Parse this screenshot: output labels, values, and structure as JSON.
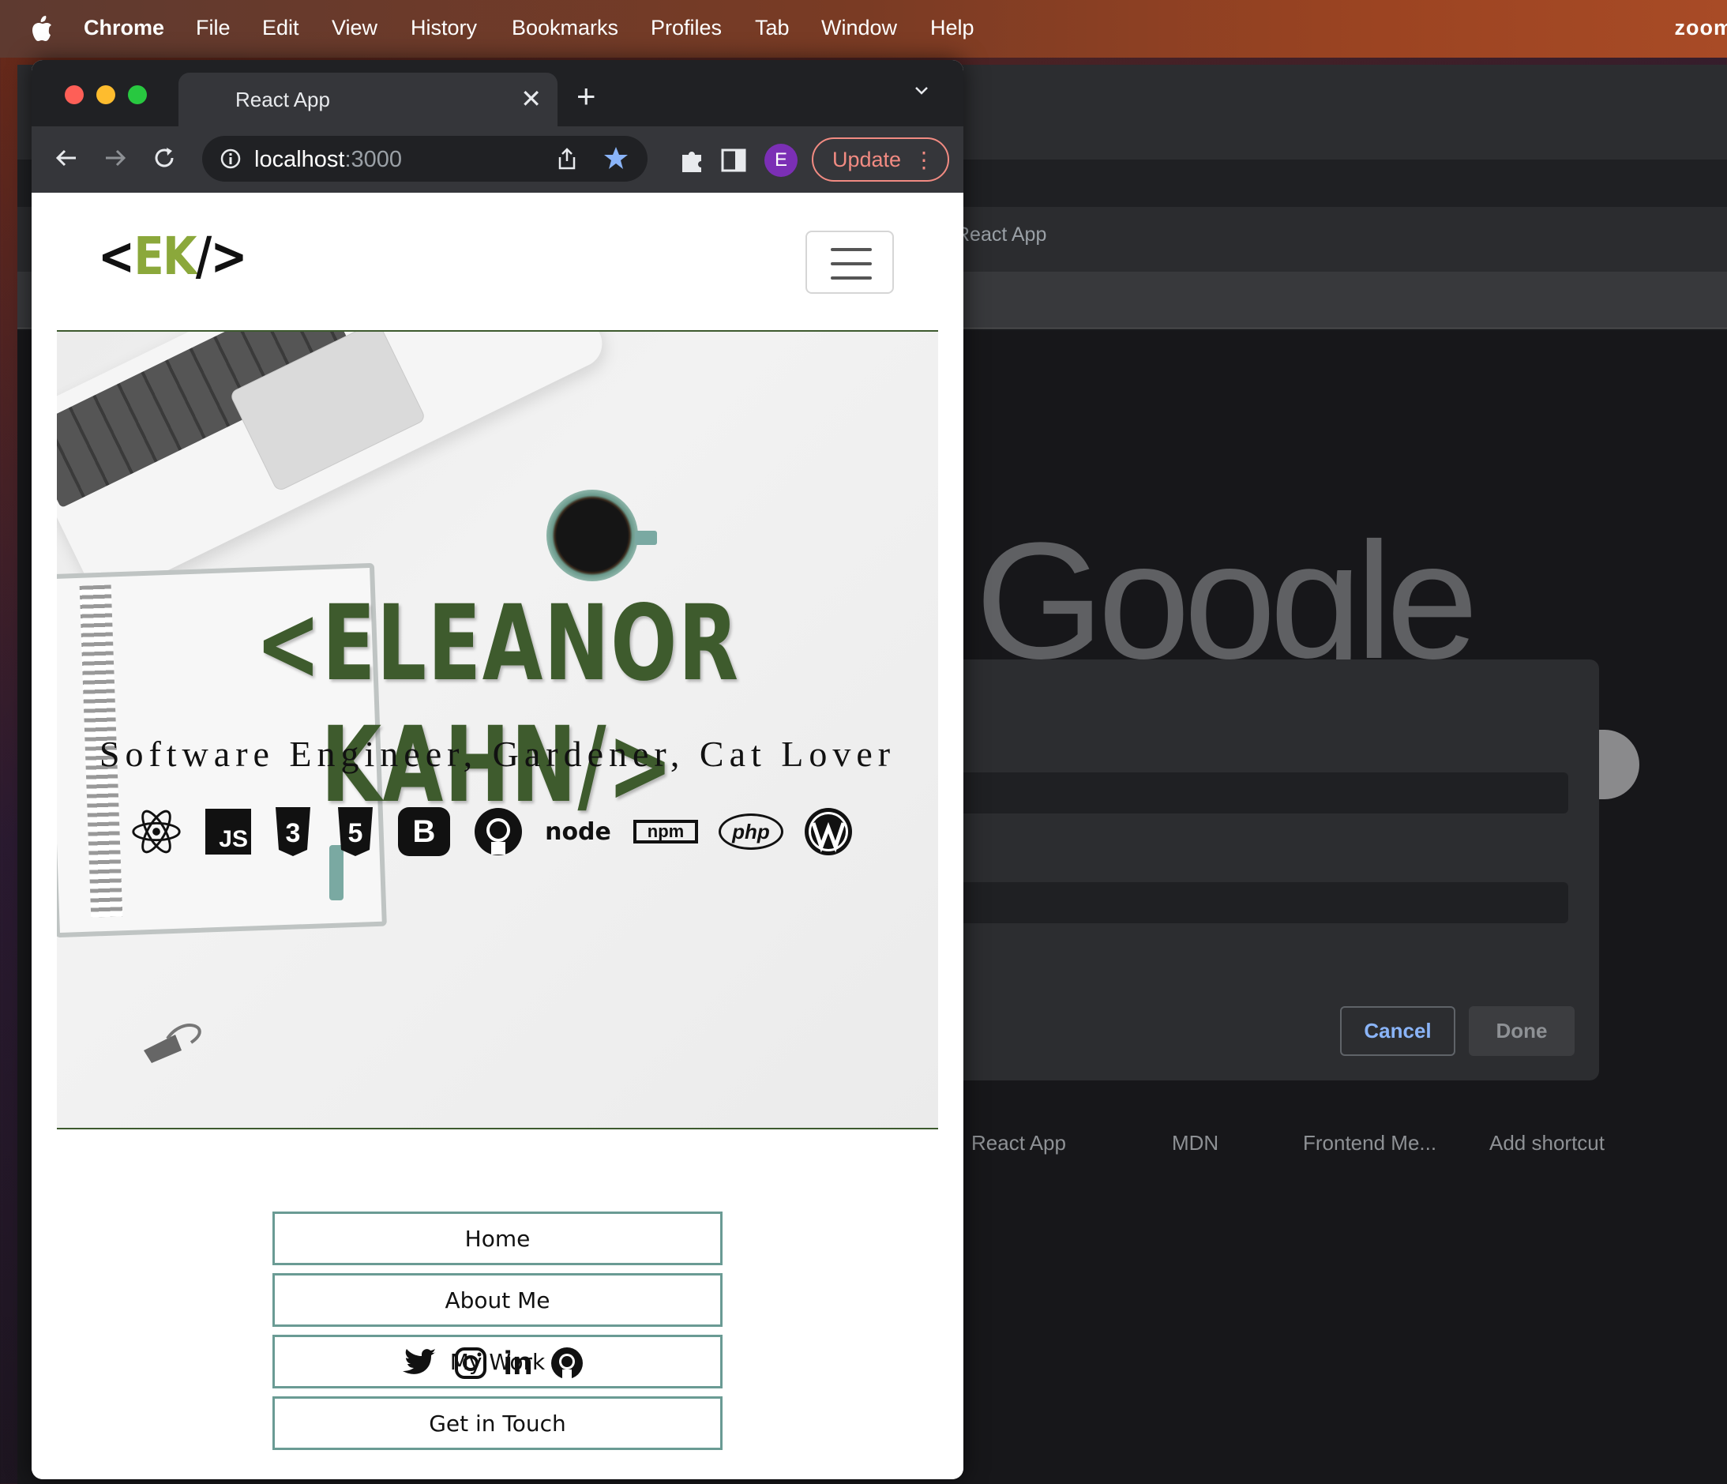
{
  "menubar": {
    "app": "Chrome",
    "items": [
      "File",
      "Edit",
      "View",
      "History",
      "Bookmarks",
      "Profiles",
      "Tab",
      "Window",
      "Help"
    ],
    "right_app": "zoom"
  },
  "browser": {
    "tab_title": "React App",
    "tab_close": "✕",
    "new_tab": "+",
    "url_host": "localhost",
    "url_port": ":3000",
    "profile_initial": "E",
    "update_label": "Update",
    "update_menu": "⋮"
  },
  "site": {
    "logo_left": "<",
    "logo_initials": "EK",
    "logo_right": "/>",
    "hero_name": "<ELEANOR KAHN/>",
    "hero_subtitle": "Software Engineer, Gardener, Cat Lover",
    "tech_icons": [
      "react-icon",
      "javascript-icon",
      "css3-icon",
      "html5-icon",
      "bootstrap-icon",
      "github-icon",
      "nodejs-icon",
      "npm-icon",
      "php-icon",
      "wordpress-icon"
    ],
    "tech_labels": {
      "javascript": "JS",
      "css3": "3",
      "html5": "5",
      "bootstrap": "B",
      "node": "node",
      "npm": "npm",
      "php": "php"
    },
    "nav": [
      "Home",
      "About Me",
      "My Work",
      "Get in Touch"
    ],
    "social_icons": [
      "twitter-icon",
      "instagram-icon",
      "linkedin-icon",
      "github-icon"
    ],
    "linkedin_label": "in"
  },
  "background_window": {
    "tab_title": "React App",
    "logo": "Google",
    "dialog": {
      "cancel": "Cancel",
      "done": "Done"
    },
    "shortcuts": [
      "React App",
      "MDN",
      "Frontend Me...",
      "Add shortcut"
    ]
  },
  "colors": {
    "accent_green": "#3e5b2d",
    "logo_green": "#8ba83b",
    "nav_border": "#6a9b94",
    "update_red": "#f28b82",
    "profile_purple": "#7b2fb5"
  }
}
